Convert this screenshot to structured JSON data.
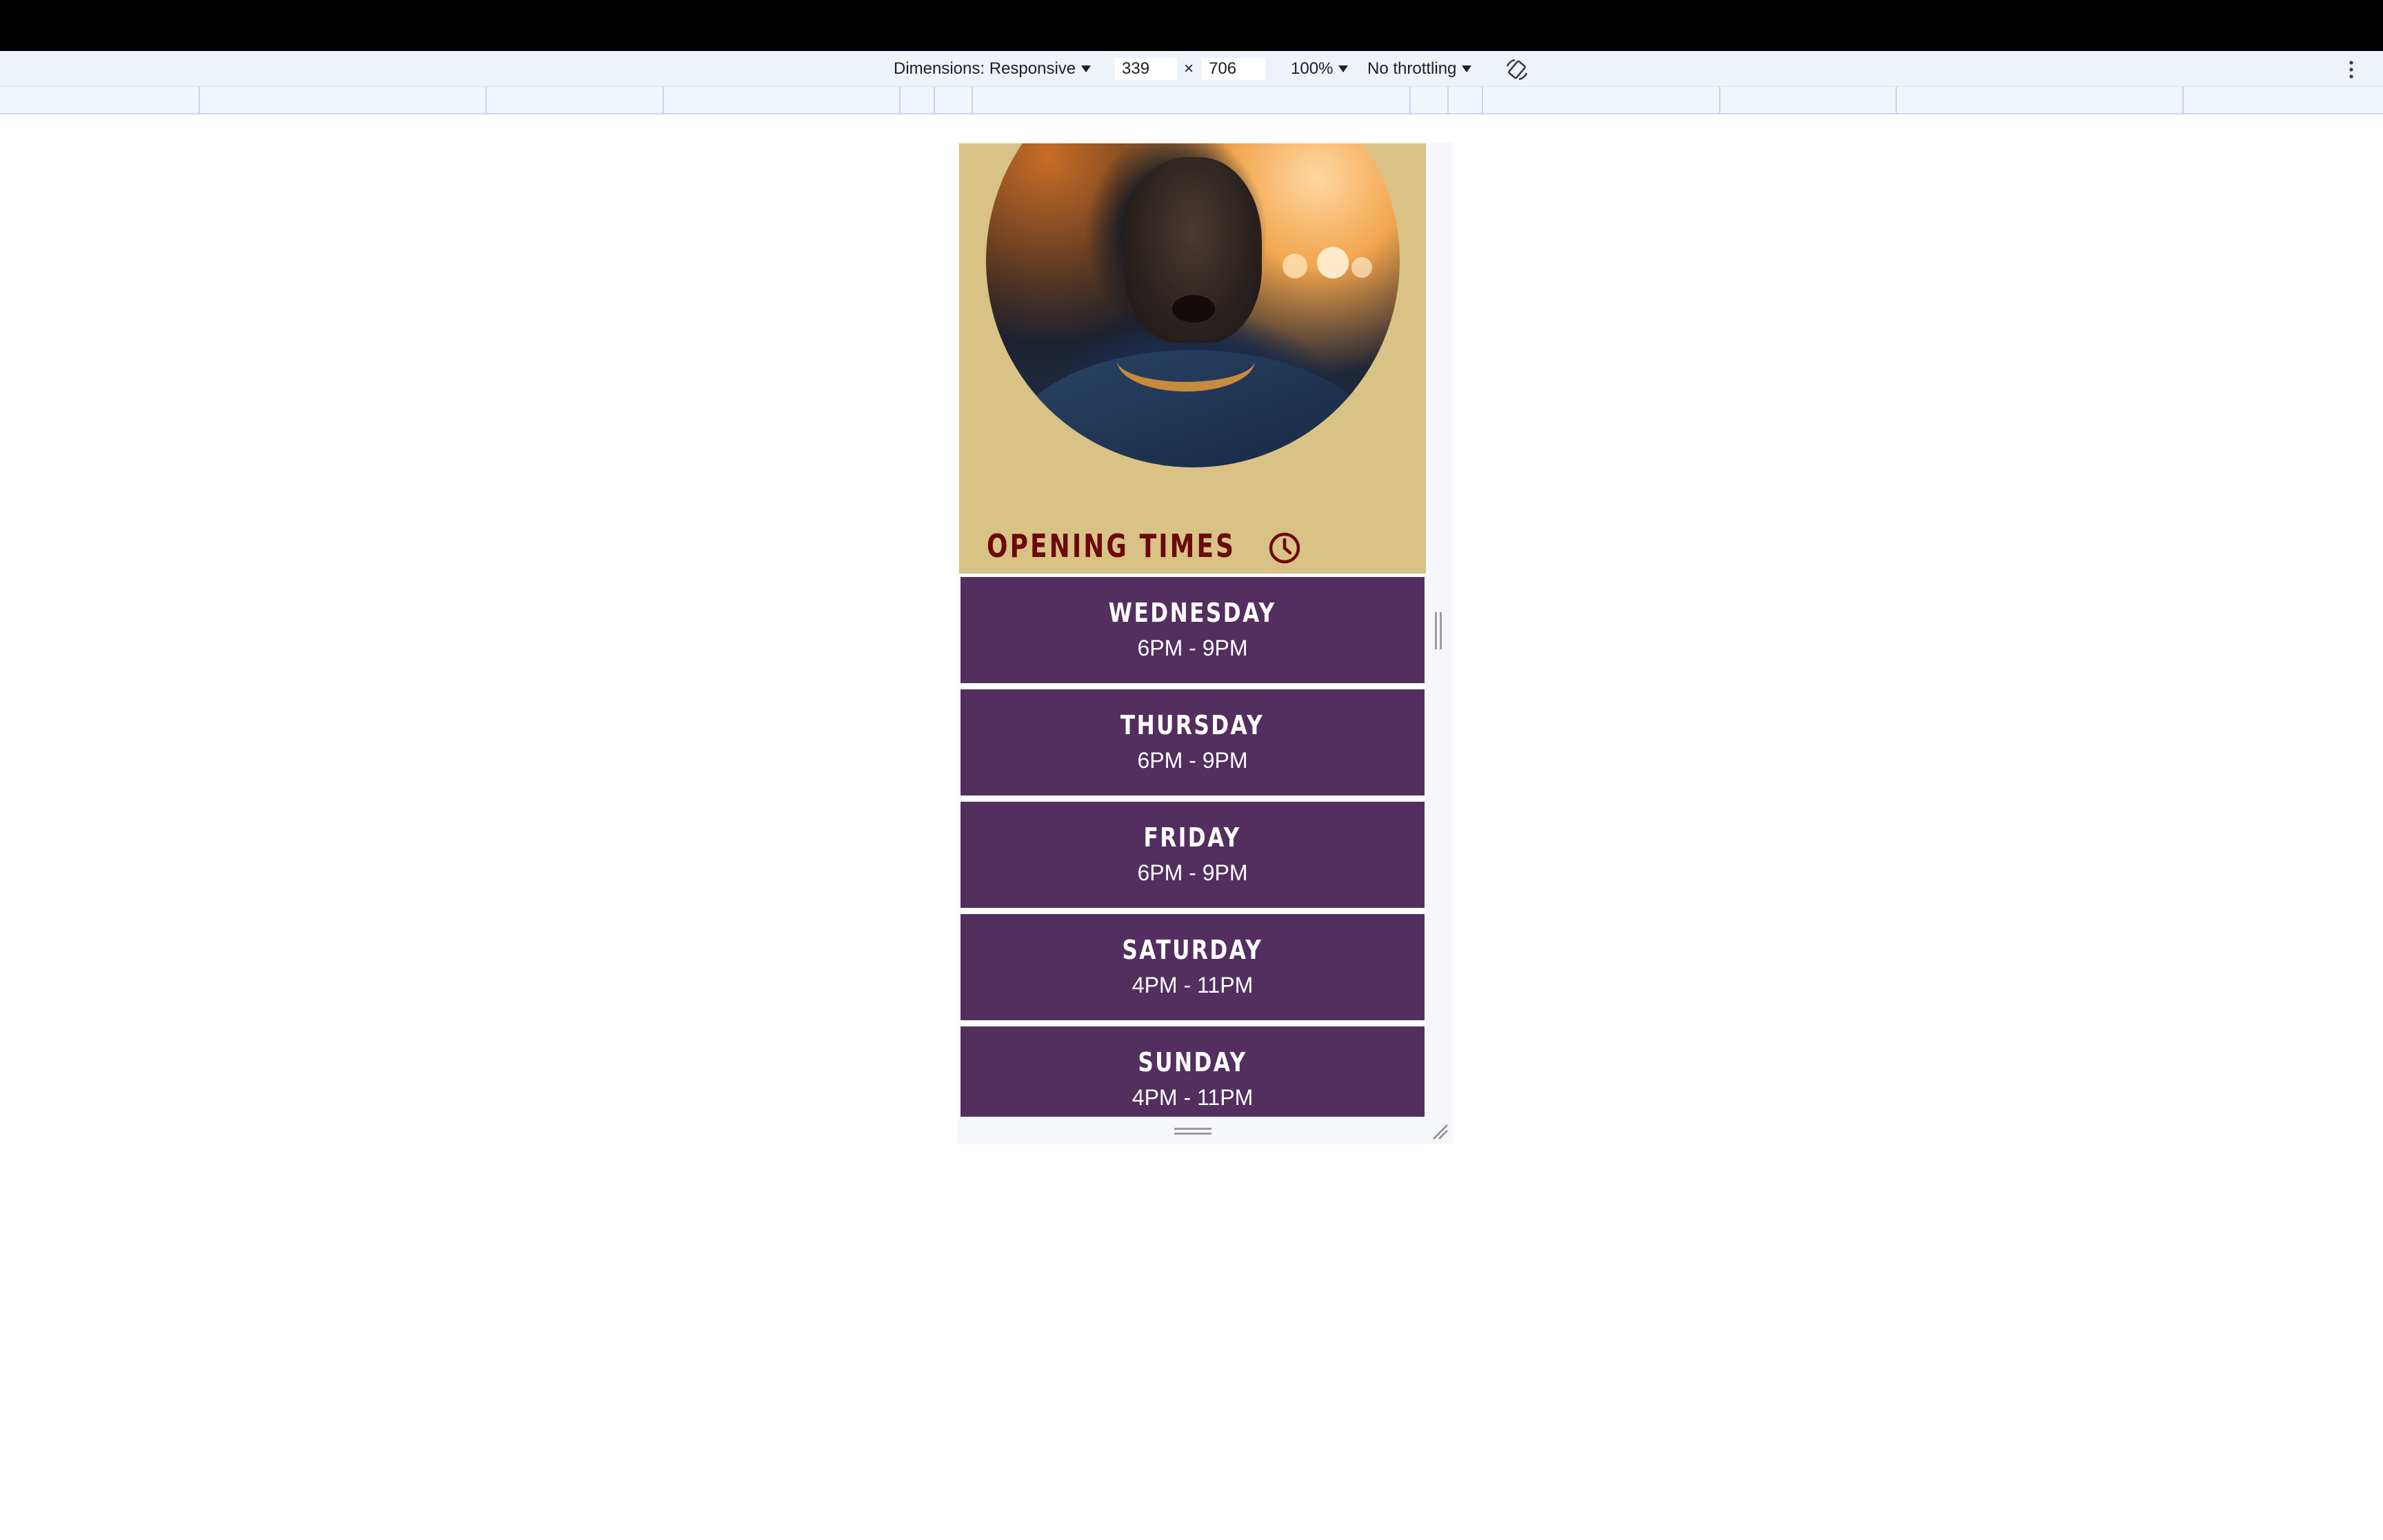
{
  "devtools": {
    "dimensions_label": "Dimensions: Responsive",
    "width_value": "339",
    "times_symbol": "×",
    "height_value": "706",
    "zoom_label": "100%",
    "throttling_label": "No throttling",
    "rotate_icon": "rotate-icon",
    "more_icon": "kebab-menu-icon"
  },
  "page": {
    "hero": {
      "image": "player-photo",
      "title": "OPENING TIMES",
      "title_icon": "clock-icon",
      "title_color": "#6b0a0a",
      "background_color": "#d8c286"
    },
    "card_color": "#522f5f",
    "days": [
      {
        "day": "WEDNESDAY",
        "hours": "6PM - 9PM"
      },
      {
        "day": "THURSDAY",
        "hours": "6PM - 9PM"
      },
      {
        "day": "FRIDAY",
        "hours": "6PM - 9PM"
      },
      {
        "day": "SATURDAY",
        "hours": "4PM - 11PM"
      },
      {
        "day": "SUNDAY",
        "hours": "4PM - 11PM"
      }
    ]
  }
}
